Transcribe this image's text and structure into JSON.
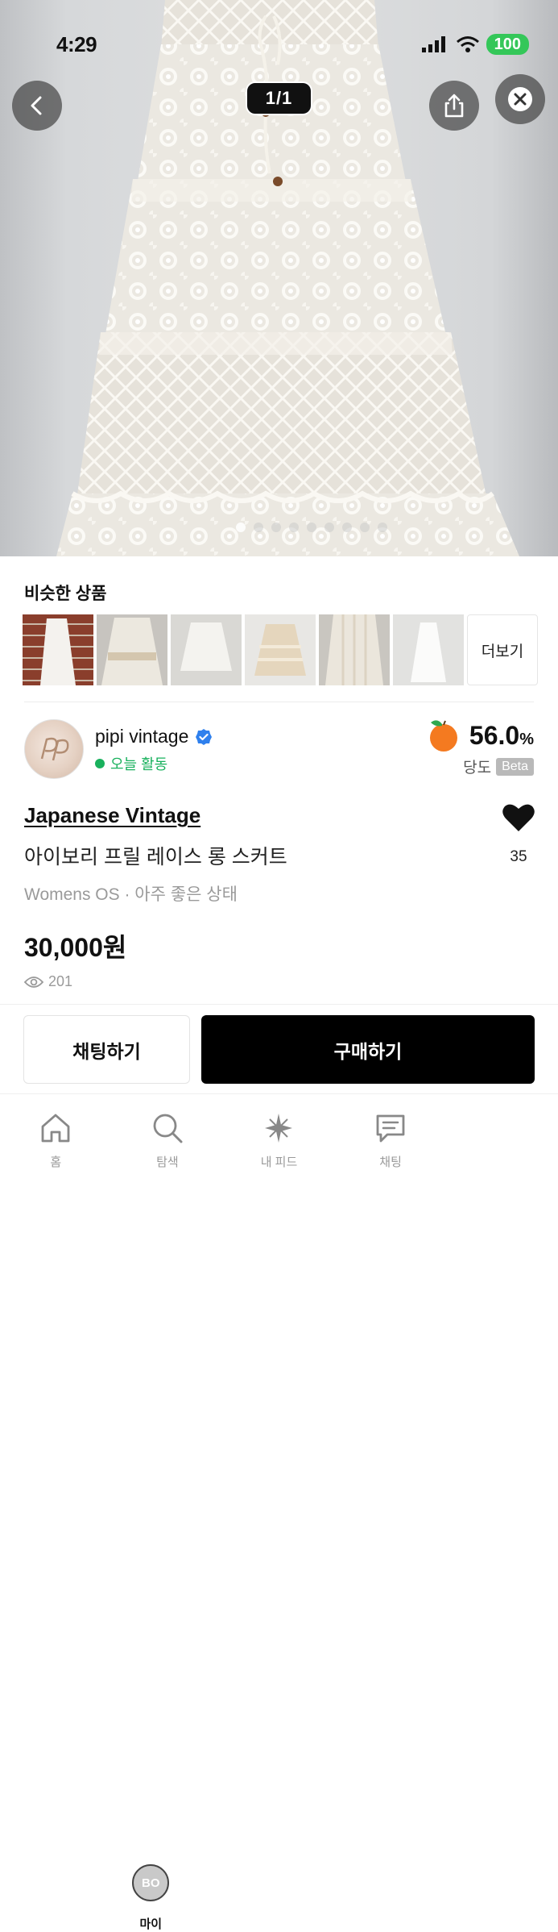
{
  "status_bar": {
    "time": "4:29",
    "battery": "100"
  },
  "viewer": {
    "counter": "1/1",
    "back_icon": "chevron-left-icon",
    "share_icon": "share-icon",
    "close_icon": "close-circle-icon"
  },
  "similar": {
    "title": "비슷한 상품",
    "more_label": "더보기",
    "items": [
      "thumb-1",
      "thumb-2",
      "thumb-3",
      "thumb-4",
      "thumb-5",
      "thumb-6"
    ]
  },
  "seller": {
    "name": "pipi vintage",
    "activity": "오늘 활동",
    "score_value": "56.0",
    "score_unit": "%",
    "score_label": "당도",
    "score_badge": "Beta",
    "colors": {
      "active": "#19b15d",
      "verified": "#2f80ed",
      "orange": "#f47a20"
    }
  },
  "product": {
    "brand": "Japanese Vintage",
    "title": "아이보리 프릴 레이스 롱 스커트",
    "meta": "Womens OS · 아주 좋은 상태",
    "price": "30,000원",
    "views": "201",
    "likes": "35"
  },
  "actions": {
    "chat_label": "채팅하기",
    "buy_label": "구매하기"
  },
  "tabbar": {
    "tabs": [
      {
        "label": "홈",
        "icon": "home-icon"
      },
      {
        "label": "탐색",
        "icon": "search-icon"
      },
      {
        "label": "내 피드",
        "icon": "sparkle-icon"
      },
      {
        "label": "채팅",
        "icon": "chat-icon"
      },
      {
        "label": "마이",
        "icon": "profile-avatar",
        "avatar_text": "BO"
      }
    ]
  }
}
